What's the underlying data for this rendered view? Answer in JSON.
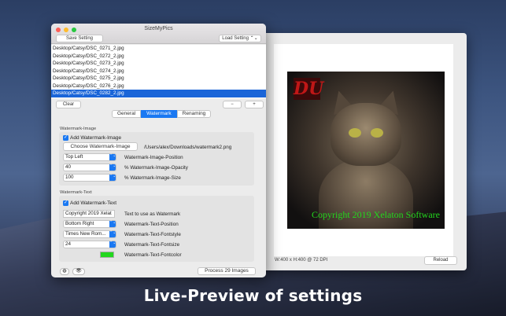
{
  "window": {
    "title": "SizeMyPics"
  },
  "toolbar": {
    "save_label": "Save Setting",
    "load_label": "Load Setting",
    "load_arrows": "⌃⌄"
  },
  "files": [
    "Desktop/Catsy/DSC_0271_2.jpg",
    "Desktop/Catsy/DSC_0272_2.jpg",
    "Desktop/Catsy/DSC_0273_2.jpg",
    "Desktop/Catsy/DSC_0274_2.jpg",
    "Desktop/Catsy/DSC_0275_2.jpg",
    "Desktop/Catsy/DSC_0276_2.jpg",
    "Desktop/Catsy/DSC_0282_2.jpg"
  ],
  "list_controls": {
    "clear_label": "Clear",
    "minus_label": "−",
    "plus_label": "+"
  },
  "tabs": [
    {
      "label": "General"
    },
    {
      "label": "Watermark"
    },
    {
      "label": "Renaming"
    }
  ],
  "watermark_image": {
    "section_label": "Watermark-Image",
    "add_label": "Add Watermark-Image",
    "checkbox_mark": "✓",
    "choose_label": "Choose Watermark-Image",
    "path": "/Users/alex/Downloads/watermark2.png",
    "position_value": "Top Left",
    "position_label": "Watermark-Image-Position",
    "opacity_value": "40",
    "opacity_label": "% Watermark-Image-Opacity",
    "size_value": "100",
    "size_label": "% Watermark-Image-Size"
  },
  "watermark_text": {
    "section_label": "Watermark-Text",
    "add_label": "Add Watermark-Text",
    "checkbox_mark": "✓",
    "text_value": "Copyright 2019 Xelat",
    "text_label": "Text to use as Watermark",
    "position_value": "Bottom Right",
    "position_label": "Watermark-Text-Position",
    "font_value": "Times New Rom...",
    "font_label": "Watermark-Text-Fontstyle",
    "fontsize_value": "24",
    "fontsize_label": "Watermark-Text-Fontsize",
    "fontcolor_label": "Watermark-Text-Fontcolor",
    "fontcolor": "#22d71d"
  },
  "bottom": {
    "process_label": "Process 29 Images",
    "select_arrows": "⌃⌄"
  },
  "preview": {
    "logo_text": "DU",
    "watermark_text": "Copyright 2019 Xelaton Software",
    "status": "W:400 x H:400 @ 72 DPI",
    "reload_label": "Reload"
  },
  "caption": "Live-Preview of settings",
  "icons": {
    "globe": "globe-icon",
    "eye": "eye-icon"
  }
}
